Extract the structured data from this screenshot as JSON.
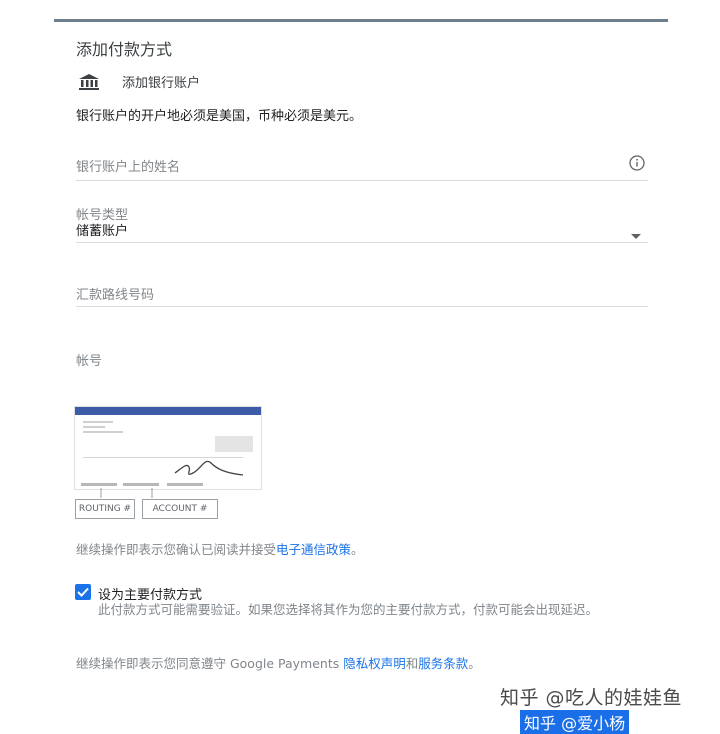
{
  "page": {
    "title": "添加付款方式",
    "bank_option_label": "添加银行账户",
    "notice": "银行账户的开户地必须是美国，币种必须是美元。"
  },
  "form": {
    "account_holder_name_placeholder": "银行账户上的姓名",
    "account_type_label": "帐号类型",
    "account_type_value": "储蓄账户",
    "routing_number_placeholder": "汇款路线号码",
    "account_number_placeholder": "帐号"
  },
  "check_illustration": {
    "routing_label": "ROUTING #",
    "account_label": "ACCOUNT #"
  },
  "consent": {
    "text": "继续操作即表示您确认已阅读并接受",
    "link": "电子通信政策",
    "suffix": "。"
  },
  "primary_payment": {
    "checked": true,
    "label": "设为主要付款方式",
    "description": "此付款方式可能需要验证。如果您选择将其作为您的主要付款方式，付款可能会出现延迟。"
  },
  "terms": {
    "text": "继续操作即表示您同意遵守 Google Payments ",
    "privacy_link": "隐私权声明",
    "and": "和",
    "service_link": "服务条款",
    "suffix": "。"
  },
  "watermark": {
    "text": "知乎 @吃人的娃娃鱼",
    "text2": "知乎 @爱小杨"
  },
  "colors": {
    "accent": "#1a73e8",
    "check_header": "#3c5ca8"
  }
}
